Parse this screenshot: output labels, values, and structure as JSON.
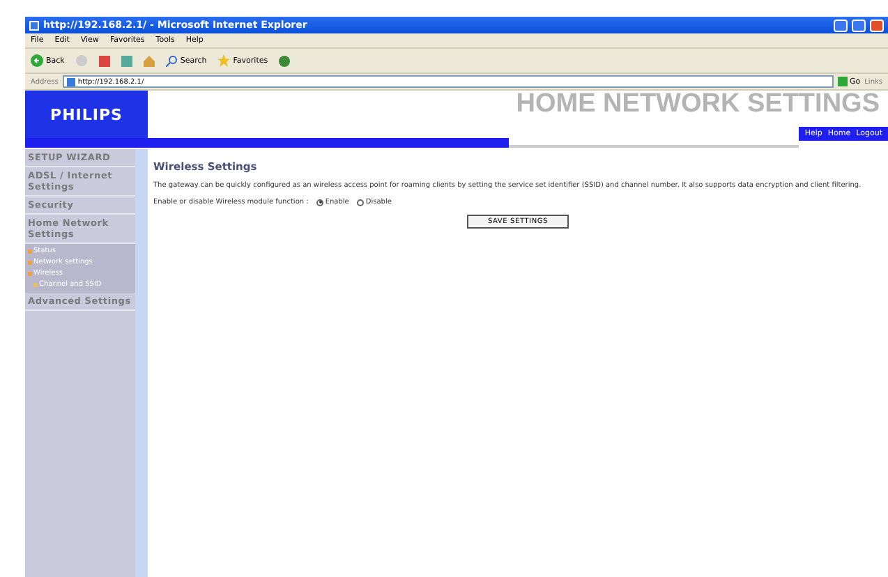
{
  "window": {
    "title": "http://192.168.2.1/ - Microsoft Internet Explorer"
  },
  "menu": [
    "File",
    "Edit",
    "View",
    "Favorites",
    "Tools",
    "Help"
  ],
  "toolbar": {
    "back": "Back",
    "search": "Search",
    "favorites": "Favorites"
  },
  "address_bar": {
    "label": "Address",
    "value": "http://192.168.2.1/",
    "go": "Go",
    "links": "Links"
  },
  "header": {
    "logo": "PHILIPS",
    "title": "HOME NETWORK SETTINGS",
    "links": [
      "Help",
      "Home",
      "Logout"
    ]
  },
  "sidebar": {
    "items": [
      {
        "label": "SETUP WIZARD",
        "kind": "section"
      },
      {
        "label": "ADSL / Internet Settings",
        "kind": "section"
      },
      {
        "label": "Security",
        "kind": "section"
      },
      {
        "label": "Home Network Settings",
        "kind": "section",
        "expanded": true,
        "children": [
          {
            "label": "Status",
            "kind": "sub"
          },
          {
            "label": "Network settings",
            "kind": "sub"
          },
          {
            "label": "Wireless",
            "kind": "sub",
            "children": [
              {
                "label": "Channel and SSID",
                "kind": "leaf"
              }
            ]
          }
        ]
      },
      {
        "label": "Advanced Settings",
        "kind": "section"
      }
    ]
  },
  "content": {
    "title": "Wireless Settings",
    "description": "The gateway can be quickly configured as an wireless access point for roaming clients by setting the service set identifier (SSID) and channel number. It also supports data encryption and client filtering.",
    "field_label": "Enable or disable Wireless module function :",
    "options": [
      {
        "label": "Enable",
        "selected": true
      },
      {
        "label": "Disable",
        "selected": false
      }
    ],
    "button": "SAVE SETTINGS"
  }
}
